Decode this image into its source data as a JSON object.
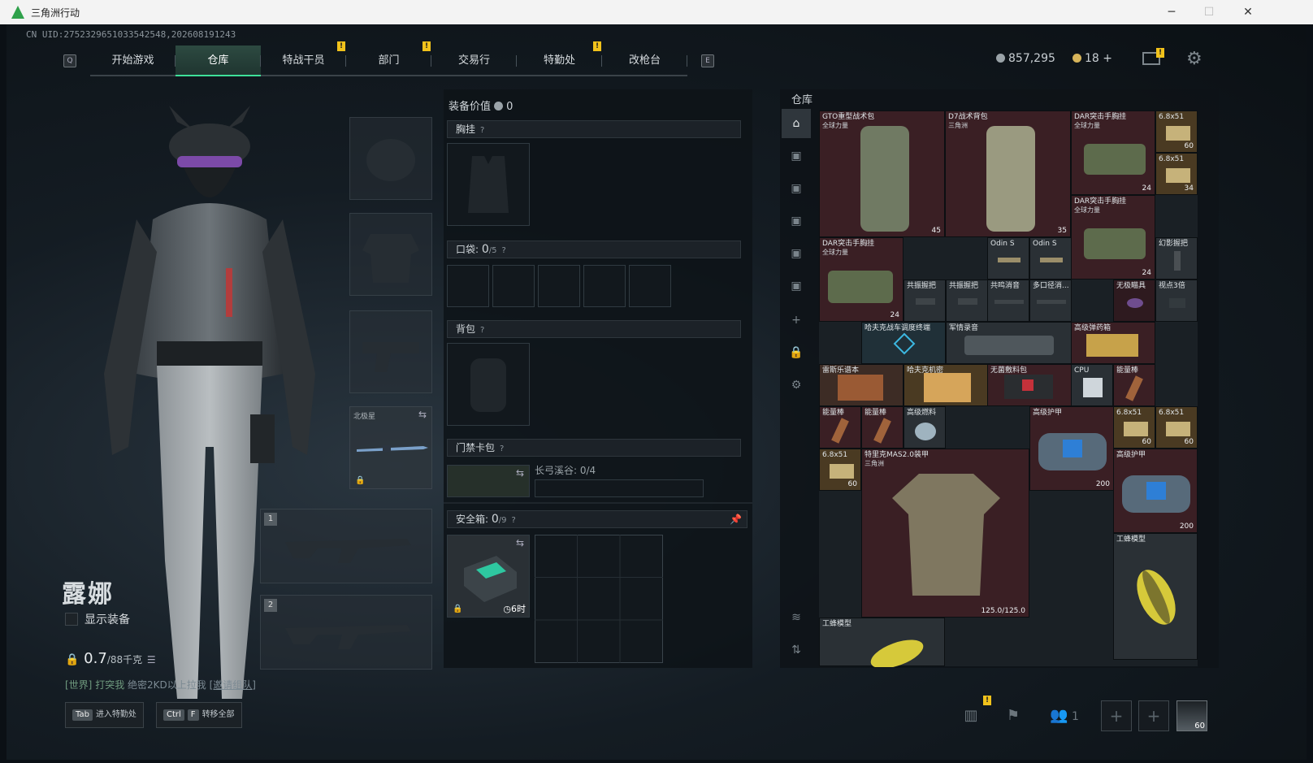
{
  "window": {
    "title": "三角洲行动",
    "minimize": "─",
    "maximize": "☐",
    "close": "✕"
  },
  "uid": "CN UID:2752329651033542548,202608191243",
  "nav": {
    "left_key": "Q",
    "right_key": "E",
    "tabs": [
      "开始游戏",
      "仓库",
      "特战干员",
      "部门",
      "交易行",
      "特勤处",
      "改枪台"
    ],
    "active_tab": "仓库",
    "badge": "!"
  },
  "currency": {
    "silver": "857,295",
    "gold": "18",
    "add": "+"
  },
  "operator": {
    "name": "露娜",
    "show_equip_label": "显示装备",
    "weight_value": "0.7",
    "weight_max": "/88千克",
    "chat_channel": "[世界]",
    "chat_user": "打突我",
    "chat_text": "绝密2KD以上拉我",
    "chat_link": "[邀请组队]"
  },
  "gear": {
    "sidearm_label": "北极星",
    "primary_num": "1",
    "secondary_num": "2"
  },
  "loadout": {
    "value_label": "装备价值",
    "value": "0",
    "chest_rig": "胸挂",
    "pockets_label": "口袋:",
    "pockets_count": "0",
    "pockets_max": "/5",
    "backpack": "背包",
    "keycard": "门禁卡包",
    "keycard_sub": "长弓溪谷: 0/4",
    "safebox_label": "安全箱:",
    "safebox_count": "0",
    "safebox_max": "/9",
    "safebox_timer": "6时",
    "help": "?"
  },
  "warehouse": {
    "title": "仓库",
    "items": [
      {
        "name": "GTO重型战术包",
        "sub": "全球力量",
        "count": "45"
      },
      {
        "name": "D7战术背包",
        "sub": "三角洲",
        "count": "35"
      },
      {
        "name": "DAR突击手胸挂",
        "sub": "全球力量",
        "count": "24"
      },
      {
        "name": "6.8x51",
        "count": "60"
      },
      {
        "name": "6.8x51",
        "count": "34"
      },
      {
        "name": "DAR突击手胸挂",
        "sub": "全球力量",
        "count": "24"
      },
      {
        "name": "DAR突击手胸挂",
        "sub": "全球力量",
        "count": "24"
      },
      {
        "name": "Odin S"
      },
      {
        "name": "Odin S"
      },
      {
        "name": "幻影握把"
      },
      {
        "name": "共振握把"
      },
      {
        "name": "共振握把"
      },
      {
        "name": "共鸣消音"
      },
      {
        "name": "多口径消..."
      },
      {
        "name": "无极瞄具"
      },
      {
        "name": "视点3倍"
      },
      {
        "name": "哈夫克战车调度终端"
      },
      {
        "name": "军情录音"
      },
      {
        "name": "高级弹药箱"
      },
      {
        "name": "雷斯乐谱本"
      },
      {
        "name": "哈夫克机密"
      },
      {
        "name": "无菌敷料包"
      },
      {
        "name": "CPU"
      },
      {
        "name": "能量棒"
      },
      {
        "name": "能量棒"
      },
      {
        "name": "能量棒"
      },
      {
        "name": "高级燃料"
      },
      {
        "name": "高级护甲",
        "count": "200"
      },
      {
        "name": "6.8x51",
        "count": "60"
      },
      {
        "name": "6.8x51",
        "count": "60"
      },
      {
        "name": "6.8x51",
        "count": "60"
      },
      {
        "name": "特里克MAS2.0装甲",
        "sub": "三角洲",
        "count": "125.0/125.0"
      },
      {
        "name": "高级护甲",
        "count": "200"
      },
      {
        "name": "工蜂模型"
      },
      {
        "name": "工蜂模型"
      }
    ]
  },
  "bottom": {
    "tab_key": "Tab",
    "tab_label": "进入特勤处",
    "ctrl_key": "Ctrl",
    "f_key": "F",
    "transfer_label": "转移全部",
    "team_count": "1",
    "plus": "+",
    "avatar_level": "60"
  },
  "colors": {
    "accent": "#3ee099",
    "badge": "#f1c21b",
    "item_red": "#3a1f24"
  }
}
